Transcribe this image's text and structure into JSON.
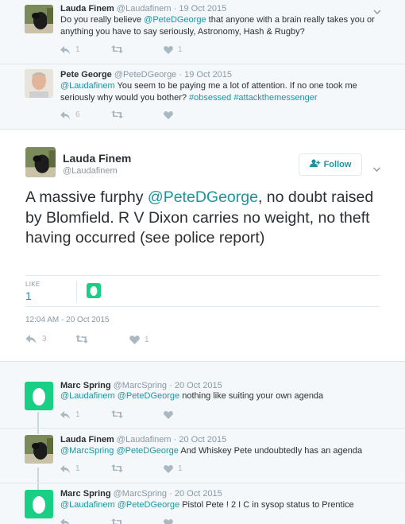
{
  "tweets_above": [
    {
      "name": "Lauda Finem",
      "handle": "@Laudafinem",
      "date": "19 Oct 2015",
      "text_before": "Do you really believe ",
      "mention": "@PeteDGeorge",
      "text_after": " that anyone with a brain really takes you or anything you have to say seriously, Astronomy, Hash & Rugby?",
      "replies": "1",
      "retweets": "",
      "likes": "1"
    },
    {
      "name": "Pete George",
      "handle": "@PeteDGeorge",
      "date": "19 Oct 2015",
      "mention": "@Laudafinem",
      "text": " You seem to be paying me a lot of attention. If no one took me seriously why would you bother? ",
      "hashtag1": "#obsessed",
      "hashtag2": "#attackthemessenger",
      "replies": "6",
      "retweets": "",
      "likes": ""
    }
  ],
  "main_tweet": {
    "name": "Lauda Finem",
    "handle": "@Laudafinem",
    "follow_label": "Follow",
    "text_before": "A massive furphy ",
    "mention": "@PeteDGeorge",
    "text_after": ", no doubt raised by Blomfield. R V Dixon carries no weight, no theft having occurred (see police report)",
    "like_label": "LIKE",
    "like_count": "1",
    "timestamp": "12:04 AM - 20 Oct 2015",
    "replies": "3",
    "retweets": "",
    "likes": "1"
  },
  "replies": [
    {
      "name": "Marc Spring",
      "handle": "@MarcSpring",
      "date": "20 Oct 2015",
      "mention1": "@Laudafinem",
      "mention2": "@PeteDGeorge",
      "text": " nothing like suiting your own agenda",
      "replies": "1",
      "retweets": "",
      "likes": ""
    },
    {
      "name": "Lauda Finem",
      "handle": "@Laudafinem",
      "date": "20 Oct 2015",
      "mention1": "@MarcSpring",
      "mention2": "@PeteDGeorge",
      "text": " And Whiskey Pete undoubtedly has an agenda",
      "replies": "1",
      "retweets": "",
      "likes": "1"
    },
    {
      "name": "Marc Spring",
      "handle": "@MarcSpring",
      "date": "20 Oct 2015",
      "mention1": "@Laudafinem",
      "mention2": "@PeteDGeorge",
      "text": " Pistol Pete ! 2 I C in sysop status to Prentice",
      "replies": "",
      "retweets": "",
      "likes": ""
    }
  ],
  "dot_separator": "·",
  "colors": {
    "link": "#1b95a0",
    "muted": "#8899a6",
    "egg_green": "#19cf86",
    "border": "#e1e8ed"
  }
}
